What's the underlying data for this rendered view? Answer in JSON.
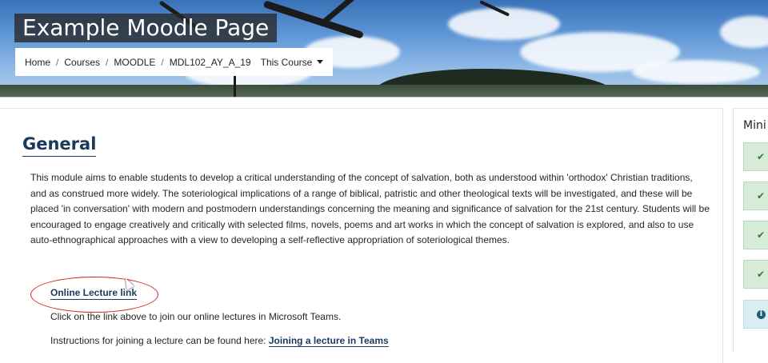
{
  "header": {
    "page_title": "Example Moodle Page",
    "breadcrumb": [
      "Home",
      "Courses",
      "MOODLE",
      "MDL102_AY_A_19"
    ],
    "course_menu_label": "This Course"
  },
  "section": {
    "title": "General",
    "summary": "This module aims to enable students to develop a critical understanding of the concept of salvation, both as understood within 'orthodox' Christian traditions, and as construed more widely. The soteriological implications of a range of biblical, patristic and other theological texts will be investigated, and these will be placed 'in conversation' with modern and postmodern understandings concerning the meaning and significance of salvation for the 21st century. Students will be encouraged to engage creatively and critically with selected films, novels, poems and art works in which the concept of salvation is explored, and also to use auto-ethnographical approaches with a view to developing a self-reflective appropriation of soteriological themes.",
    "lecture_link_label": "Online Lecture link",
    "lecture_note": "Click on the link above to join our online lectures in Microsoft Teams.",
    "instructions_text": "Instructions for joining a lecture can be found here: ",
    "instructions_link_label": "Joining a lecture in Teams"
  },
  "right_block": {
    "title": "Mini",
    "steps": [
      {
        "icon": "check-icon",
        "glyph": "✔"
      },
      {
        "icon": "check-icon",
        "glyph": "✔"
      },
      {
        "icon": "check-icon",
        "glyph": "✔"
      },
      {
        "icon": "check-icon",
        "glyph": "✔"
      },
      {
        "icon": "info-icon",
        "glyph": "i"
      }
    ]
  },
  "colors": {
    "link": "#1a3a5c",
    "annotation": "#d42020",
    "success_bg": "#d7ebd9",
    "info_bg": "#d9edf3"
  }
}
